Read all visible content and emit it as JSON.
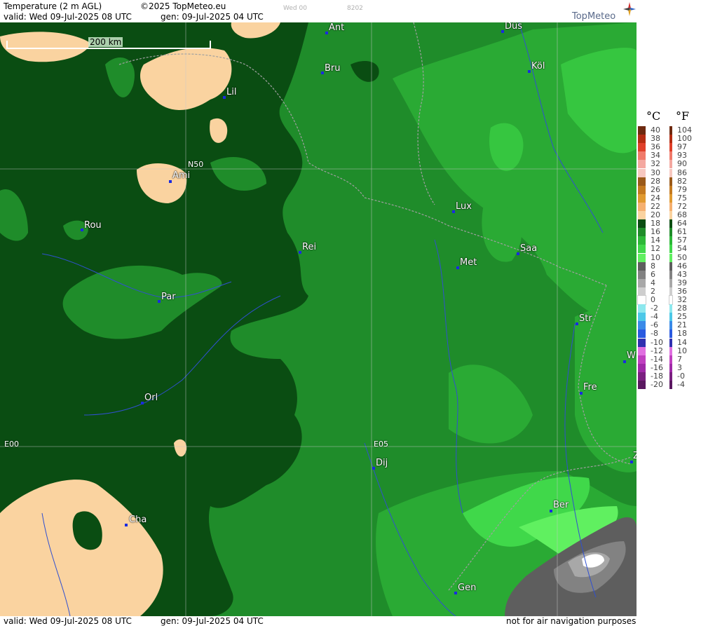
{
  "header": {
    "title": "Temperature (2 m AGL)",
    "copyright": "©2025 TopMeteo.eu",
    "run": "Wed 00",
    "code": "8202",
    "valid": "valid:  Wed  09-Jul-2025  08 UTC",
    "gen": "gen:  09-Jul-2025 04 UTC",
    "logo": "TopMeteo"
  },
  "footer": {
    "valid": "valid:  Wed  09-Jul-2025  08 UTC",
    "gen": "gen:  09-Jul-2025 04 UTC",
    "note": "not for air navigation purposes"
  },
  "map": {
    "scale_label": "200 km",
    "grid_labels": [
      "N50",
      "E00",
      "E05"
    ],
    "cities": [
      "Ant",
      "Düs",
      "Bru",
      "Köl",
      "Lil",
      "Ami",
      "Rou",
      "Lux",
      "Rei",
      "Saa",
      "Met",
      "Par",
      "Str",
      "W",
      "Fre",
      "Orl",
      "Dij",
      "Z",
      "Ber",
      "Cha",
      "Gen"
    ]
  },
  "legend": {
    "unit_c": "°C",
    "unit_f": "°F",
    "celsius": [
      "40",
      "38",
      "36",
      "34",
      "32",
      "30",
      "28",
      "26",
      "24",
      "22",
      "20",
      "18",
      "16",
      "14",
      "12",
      "10",
      "8",
      "6",
      "4",
      "2",
      "0",
      "-2",
      "-4",
      "-6",
      "-8",
      "-10",
      "-12",
      "-14",
      "-16",
      "-18",
      "-20"
    ],
    "fahrenheit": [
      "104",
      "100",
      "97",
      "93",
      "90",
      "86",
      "82",
      "79",
      "75",
      "72",
      "68",
      "64",
      "61",
      "57",
      "54",
      "50",
      "46",
      "43",
      "39",
      "36",
      "32",
      "28",
      "25",
      "21",
      "18",
      "14",
      "10",
      "7",
      "3",
      "-0",
      "-4"
    ],
    "colors": [
      "#6e2a10",
      "#b42d12",
      "#e0402a",
      "#f07a6a",
      "#f4a8a0",
      "#f7c8c0",
      "#9a5a1a",
      "#c47a20",
      "#e09a30",
      "#f5b070",
      "#fad3a0",
      "#0a4d12",
      "#1f8c2a",
      "#2db838",
      "#40d84a",
      "#60f060",
      "#5e5e5e",
      "#828282",
      "#a8a8a8",
      "#cecece",
      "#ffffff",
      "#8ee8ee",
      "#4cc8e8",
      "#3a8ae8",
      "#2a5ae0",
      "#3030b0",
      "#e070e0",
      "#c040c0",
      "#a02aa8",
      "#7a2080",
      "#5a1860"
    ]
  }
}
